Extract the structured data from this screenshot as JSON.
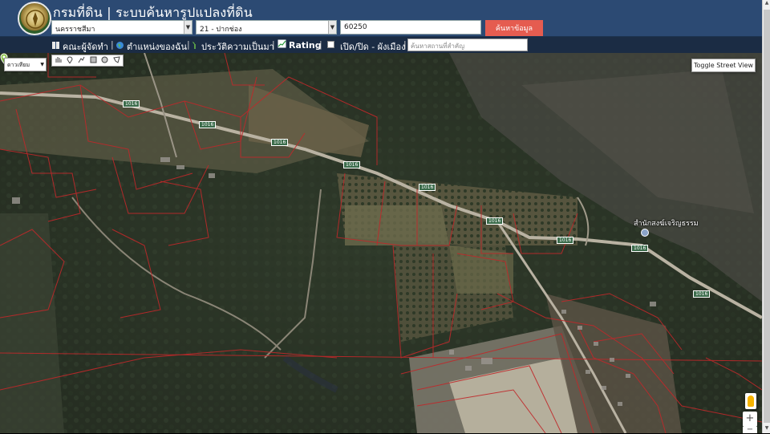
{
  "header": {
    "title": "กรมที่ดิน | ระบบค้นหารูปแปลงที่ดิน",
    "province_select": {
      "value": "นครราชสีมา"
    },
    "district_select": {
      "value": "21 - ปากช่อง"
    },
    "postal_input": {
      "value": "60250"
    },
    "search_button": {
      "label": "ค้นหาข้อมูล"
    }
  },
  "navbar": {
    "items": [
      {
        "label": "คณะผู้จัดทำ",
        "icon": "book-icon"
      },
      {
        "label": "ตำแหน่งของฉัน",
        "icon": "globe-icon"
      },
      {
        "label": "ประวัติความเป็นมา",
        "icon": "sprout-icon"
      },
      {
        "label": "Rating",
        "icon": "chart-icon"
      },
      {
        "label": "เปิด/ปิด - ผังเมือง",
        "icon": "checkbox"
      }
    ],
    "separator": "|",
    "place_search": {
      "placeholder": "ค้นหาสถานที่สำคัญ"
    }
  },
  "map": {
    "map_type": "ดาวเทียม",
    "street_view_button": "Toggle Street View",
    "poi_label": "สำนักสงฆ์เจริญธรรม",
    "road_labels": [
      "1016",
      "1016",
      "1016",
      "1016",
      "1016",
      "1016",
      "1016",
      "1016",
      "1016"
    ],
    "zoom_in": "+",
    "zoom_out": "−",
    "draw_tools": [
      "hand-icon",
      "marker-icon",
      "polyline-icon",
      "rectangle-icon",
      "circle-icon",
      "polygon-icon"
    ]
  },
  "colors": {
    "header_bg": "#2c4a73",
    "navbar_bg": "#1b2c44",
    "search_button": "#e55c50",
    "parcel_lines": "#c0282a"
  }
}
